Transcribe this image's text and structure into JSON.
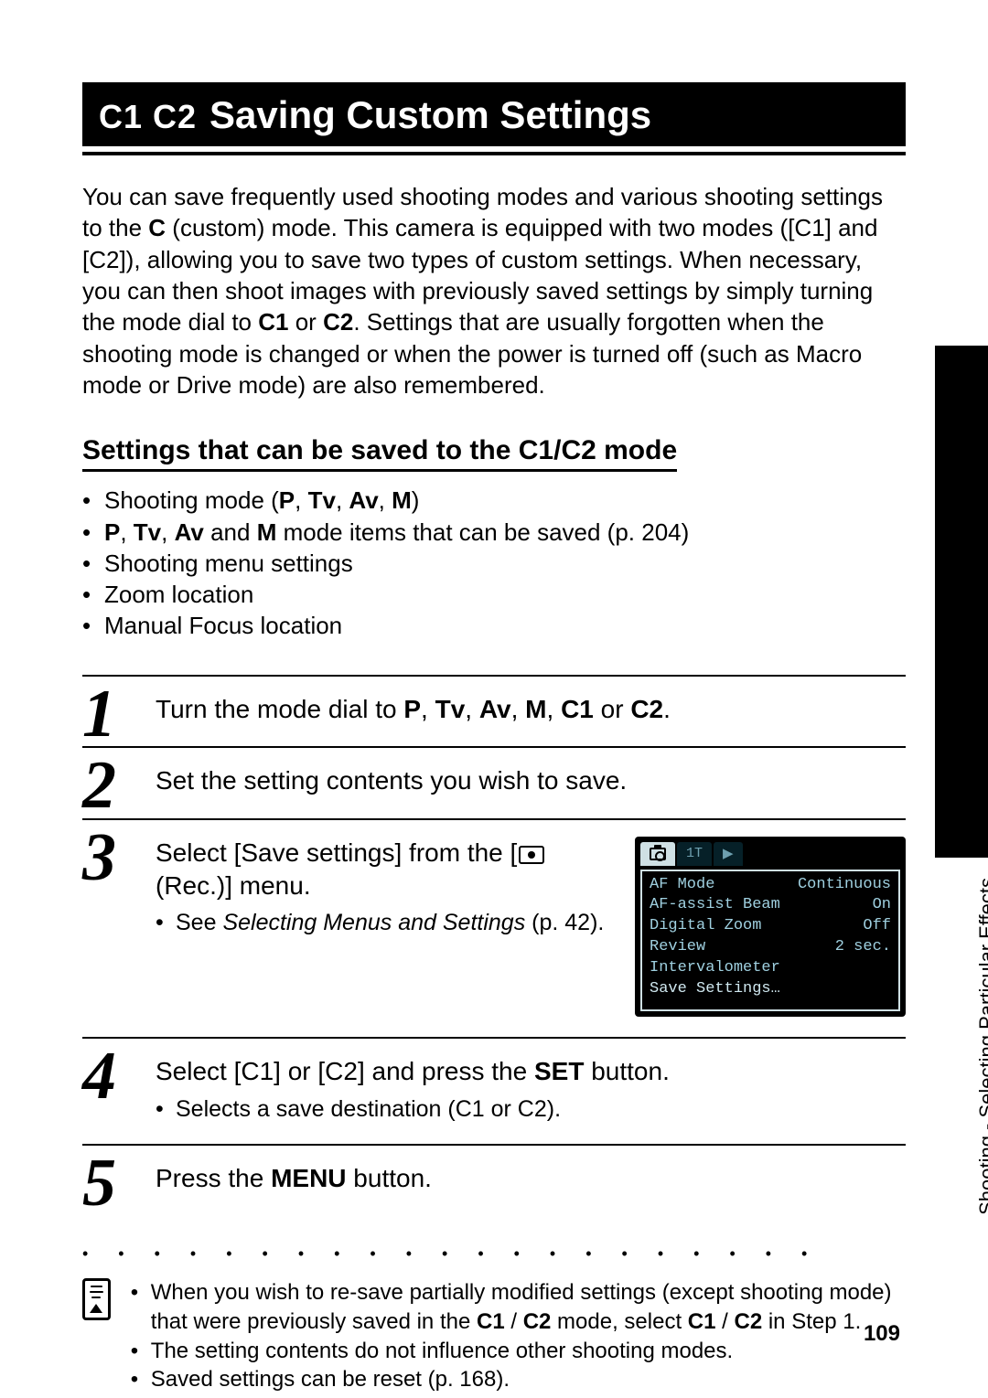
{
  "heading": {
    "mode_prefix": "C1 C2",
    "title": "Saving Custom Settings"
  },
  "intro": {
    "p1a": "You can save frequently used shooting modes and various shooting settings to the ",
    "p1b": "C",
    "p1c": " (custom) mode. This camera is equipped with two modes ([C1] and [C2]), allowing you to save two types of custom settings. When necessary, you can then shoot images with previously saved settings by simply turning the mode dial to ",
    "p1d": "C1",
    "p1e": " or ",
    "p1f": "C2",
    "p1g": ". Settings that are usually forgotten when the shooting mode is changed or when the power is turned off (such as Macro mode or Drive mode) are also remembered."
  },
  "sub_heading": "Settings that can be saved to the C1/C2 mode",
  "settings": {
    "i1a": "Shooting mode (",
    "i1b": "P",
    "i1c": ", ",
    "i1d": "Tv",
    "i1e": ", ",
    "i1f": "Av",
    "i1g": ", ",
    "i1h": "M",
    "i1i": ")",
    "i2a": "P",
    "i2b": ", ",
    "i2c": "Tv",
    "i2d": ", ",
    "i2e": "Av",
    "i2f": " and ",
    "i2g": "M",
    "i2h": " mode items that can be saved (p. 204)",
    "i3": "Shooting menu settings",
    "i4": "Zoom location",
    "i5": "Manual Focus location"
  },
  "steps": {
    "s1": {
      "num": "1",
      "a": "Turn the mode dial to ",
      "b": "P",
      "c": ", ",
      "d": "Tv",
      "e": ", ",
      "f": "Av",
      "g": ", ",
      "h": "M",
      "i": ", ",
      "j": "C1",
      "k": " or ",
      "l": "C2",
      "m": "."
    },
    "s2": {
      "num": "2",
      "text": "Set the setting contents you wish to save."
    },
    "s3": {
      "num": "3",
      "a": "Select [Save settings] from the [",
      "b": " (Rec.)] menu.",
      "sub_a": "See ",
      "sub_b": "Selecting Menus and Settings",
      "sub_c": " (p. 42)."
    },
    "s4": {
      "num": "4",
      "a": "Select [C1] or [C2] and press the ",
      "b": "SET",
      "c": " button.",
      "sub": "Selects a save destination (C1 or C2)."
    },
    "s5": {
      "num": "5",
      "a": "Press the ",
      "b": "MENU",
      "c": " button."
    }
  },
  "lcd": {
    "tabs": {
      "t2": "1T",
      "t3": "▶"
    },
    "rows": [
      {
        "label": "AF Mode",
        "value": "Continuous"
      },
      {
        "label": "AF-assist Beam",
        "value": "On"
      },
      {
        "label": "Digital Zoom",
        "value": "Off"
      },
      {
        "label": "Review",
        "value": "2 sec."
      },
      {
        "label": "Intervalometer",
        "value": ""
      },
      {
        "label": "Save Settings…",
        "value": ""
      }
    ]
  },
  "notes": {
    "n1a": "When you wish to re-save partially modified settings (except shooting mode) that were previously saved in the ",
    "n1b": "C1",
    "n1c": " / ",
    "n1d": "C2",
    "n1e": " mode, select ",
    "n1f": "C1",
    "n1g": " / ",
    "n1h": "C2",
    "n1i": " in Step 1.",
    "n2": "The setting contents do not influence other shooting modes.",
    "n3": "Saved settings can be reset (p. 168)."
  },
  "side_label": "Shooting - Selecting Particular Effects",
  "page_number": "109",
  "dots": "• • • • • • • • • • • • • • • • • • • • •"
}
